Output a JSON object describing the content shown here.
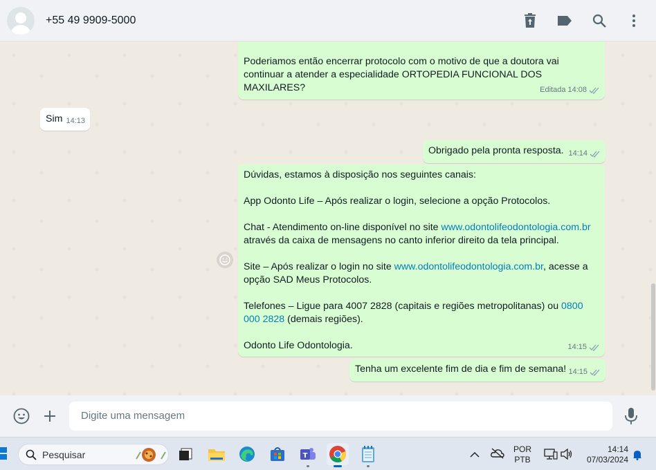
{
  "header": {
    "contact": "+55 49 9909-5000",
    "icons": [
      "delete-icon",
      "label-icon",
      "search-icon",
      "menu-icon"
    ]
  },
  "messages": [
    {
      "type": "out",
      "text": "Poderiamos então encerrar protocolo com o motivo de que a doutora vai continuar a atender a especialidade ORTOPEDIA FUNCIONAL DOS MAXILARES?",
      "edited": "Editada",
      "time": "14:08"
    },
    {
      "type": "in",
      "text": "Sim",
      "time": "14:13"
    },
    {
      "type": "out",
      "text": "Obrigado pela pronta resposta.",
      "time": "14:14"
    },
    {
      "type": "out",
      "p1": "Dúvidas, estamos à disposição nos seguintes canais:",
      "p2": "App Odonto Life – Após realizar o login, selecione a opção Protocolos.",
      "p3a": "Chat - Atendimento on-line disponível no site ",
      "p3link": "www.odontolifeodontologia.com.br",
      "p3b": " através da caixa de mensagens no canto inferior direito da tela principal.",
      "p4a": "Site – Após realizar o login no site ",
      "p4link": "www.odontolifeodontologia.com.br",
      "p4b": ", acesse a opção SAD Meus Protocolos.",
      "p5a": "Telefones – Ligue para 4007 2828 (capitais e regiões metropolitanas) ou ",
      "p5link": "0800 000 2828",
      "p5b": " (demais regiões).",
      "p6": "Odonto Life Odontologia.",
      "time": "14:15"
    },
    {
      "type": "out",
      "text": "Tenha um excelente fim de dia e fim de semana!",
      "time": "14:15"
    }
  ],
  "composer": {
    "placeholder": "Digite uma mensagem"
  },
  "taskbar": {
    "search_label": "Pesquisar",
    "lang_line1": "POR",
    "lang_line2": "PTB",
    "time": "14:14",
    "date": "07/03/2024"
  },
  "colors": {
    "outgoing_bubble": "#d9fdd3",
    "incoming_bubble": "#ffffff",
    "chat_background": "#efeae2",
    "link": "#027eb5",
    "read_ticks": "#53bdeb"
  }
}
